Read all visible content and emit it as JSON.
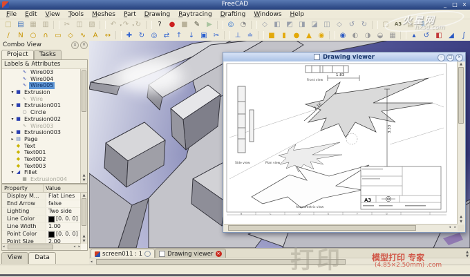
{
  "window": {
    "title": "FreeCAD",
    "controls": {
      "minimize": "_",
      "maximize": "□",
      "close": "×"
    }
  },
  "menu": {
    "items": [
      "File",
      "Edit",
      "View",
      "Tools",
      "Meshes",
      "Part",
      "Drawing",
      "Raytracing",
      "Drafting",
      "Windows",
      "Help"
    ]
  },
  "toolbars": {
    "row1": [
      {
        "name": "new-file",
        "glyph": "□",
        "color": "#c9ba7c"
      },
      {
        "name": "open-file",
        "glyph": "▤",
        "color": "#3a6fbd"
      },
      {
        "name": "save-file",
        "glyph": "▦",
        "color": "#b9b29a"
      },
      {
        "name": "print",
        "glyph": "▥",
        "color": "#b9b29a"
      },
      "|",
      {
        "name": "cut",
        "glyph": "✂",
        "color": "#b9b29a"
      },
      {
        "name": "copy",
        "glyph": "◫",
        "color": "#b9b29a"
      },
      {
        "name": "paste",
        "glyph": "▧",
        "color": "#b9b29a"
      },
      "|",
      {
        "name": "undo",
        "glyph": "↶",
        "color": "#b9b29a",
        "dd": true
      },
      {
        "name": "redo",
        "glyph": "↷",
        "color": "#b9b29a",
        "dd": true
      },
      {
        "name": "refresh",
        "glyph": "↻",
        "color": "#b9b29a"
      },
      "|",
      {
        "name": "whats-this",
        "glyph": "?",
        "color": "#1a1a1a"
      },
      {
        "name": "macro-record",
        "glyph": "●",
        "color": "#cc2020"
      },
      {
        "name": "macro-stop",
        "glyph": "■",
        "color": "#b9b29a"
      },
      {
        "name": "macro-edit",
        "glyph": "✎",
        "color": "#4a4a38"
      },
      {
        "name": "macro-play",
        "glyph": "▶",
        "color": "#a9c49f"
      },
      "|",
      {
        "name": "zoom-fit",
        "glyph": "◎",
        "color": "#2a6fd0"
      },
      {
        "name": "draw-style",
        "glyph": "◔",
        "color": "#8a8a8a"
      },
      "|",
      {
        "name": "view-axonometric",
        "glyph": "◇",
        "color": "#9aa0ab"
      },
      {
        "name": "view-front",
        "glyph": "◧",
        "color": "#9aa0ab"
      },
      {
        "name": "view-top",
        "glyph": "◩",
        "color": "#9aa0ab"
      },
      {
        "name": "view-right",
        "glyph": "◨",
        "color": "#9aa0ab"
      },
      {
        "name": "view-rear",
        "glyph": "◪",
        "color": "#9aa0ab"
      },
      {
        "name": "view-bottom",
        "glyph": "◫",
        "color": "#9aa0ab"
      },
      {
        "name": "view-left",
        "glyph": "◇",
        "color": "#9aa0ab"
      },
      {
        "name": "view-rotate-left",
        "glyph": "↺",
        "color": "#8b93a8"
      },
      {
        "name": "view-rotate-right",
        "glyph": "↻",
        "color": "#8b93a8"
      },
      "|",
      {
        "name": "drawing-new-page",
        "glyph": "▢",
        "color": "#b9b29a"
      },
      {
        "name": "drawing-a3-page",
        "glyph": "A3",
        "color": "#6a6a50",
        "small": true
      },
      {
        "name": "drawing-open-svg",
        "glyph": "▤",
        "color": "#b9b29a"
      },
      {
        "name": "drawing-export-page",
        "glyph": "⇩",
        "color": "#2a6fd0"
      }
    ],
    "row2": [
      {
        "name": "draft-line",
        "glyph": "/",
        "color": "#c79400"
      },
      {
        "name": "draft-wire",
        "glyph": "N",
        "color": "#c79400"
      },
      {
        "name": "draft-circle",
        "glyph": "○",
        "color": "#c79400"
      },
      {
        "name": "draft-arc",
        "glyph": "∩",
        "color": "#c79400"
      },
      {
        "name": "draft-rectangle",
        "glyph": "▭",
        "color": "#c79400"
      },
      {
        "name": "draft-polygon",
        "glyph": "◇",
        "color": "#c79400"
      },
      {
        "name": "draft-bspline",
        "glyph": "∿",
        "color": "#c79400"
      },
      {
        "name": "draft-text",
        "glyph": "A",
        "color": "#c79400"
      },
      {
        "name": "draft-dimension",
        "glyph": "↔",
        "color": "#c79400"
      },
      "|",
      {
        "name": "draft-move",
        "glyph": "✚",
        "color": "#2a5fd0"
      },
      {
        "name": "draft-rotate",
        "glyph": "↻",
        "color": "#2a5fd0"
      },
      {
        "name": "draft-snap",
        "glyph": "◎",
        "color": "#2a5fd0"
      },
      {
        "name": "draft-offset",
        "glyph": "⇄",
        "color": "#2a5fd0"
      },
      {
        "name": "draft-upgrade",
        "glyph": "↑",
        "color": "#2a5fd0"
      },
      {
        "name": "draft-downgrade",
        "glyph": "↓",
        "color": "#2a5fd0"
      },
      {
        "name": "draft-scale",
        "glyph": "▣",
        "color": "#2a5fd0"
      },
      {
        "name": "draft-trimex",
        "glyph": "✂",
        "color": "#2a5fd0"
      },
      "|",
      {
        "name": "draft-apply-plane",
        "glyph": "⊥",
        "color": "#2a5fd0"
      },
      {
        "name": "draft-toggle-mode",
        "glyph": "≐",
        "color": "#2a5fd0"
      },
      "|",
      {
        "name": "part-box",
        "glyph": "■",
        "color": "#e3a90a"
      },
      {
        "name": "part-cylinder",
        "glyph": "▮",
        "color": "#e3a90a"
      },
      {
        "name": "part-sphere",
        "glyph": "●",
        "color": "#e3a90a"
      },
      {
        "name": "part-cone",
        "glyph": "▲",
        "color": "#e3a90a"
      },
      {
        "name": "part-torus",
        "glyph": "◉",
        "color": "#e3a90a"
      },
      "|",
      {
        "name": "part-union",
        "glyph": "◉",
        "color": "#2857c2"
      },
      {
        "name": "part-common",
        "glyph": "◐",
        "color": "#9a9a9a"
      },
      {
        "name": "part-cut",
        "glyph": "◑",
        "color": "#9a9a9a"
      },
      {
        "name": "part-section",
        "glyph": "◒",
        "color": "#9a9a9a"
      },
      {
        "name": "part-compound",
        "glyph": "▦",
        "color": "#9a9a9a"
      },
      "|",
      {
        "name": "part-extrude",
        "glyph": "▴",
        "color": "#2857c2"
      },
      {
        "name": "part-revolve",
        "glyph": "↺",
        "color": "#2857c2"
      },
      {
        "name": "part-mirror",
        "glyph": "◧",
        "color": "#c23a3a"
      },
      {
        "name": "part-fillet",
        "glyph": "◢",
        "color": "#2857c2"
      },
      {
        "name": "part-sweep",
        "glyph": "∫",
        "color": "#2857c2"
      }
    ]
  },
  "combo_view": {
    "title": "Combo View",
    "tabs": [
      {
        "label": "Project",
        "active": true
      },
      {
        "label": "Tasks",
        "active": false
      }
    ],
    "tree_header": "Labels & Attributes",
    "icon_map": {
      "wire": {
        "glyph": "∿",
        "color": "#2a3fb0"
      },
      "extrusion": {
        "glyph": "■",
        "color": "#2a3fb0"
      },
      "circle": {
        "glyph": "○",
        "color": "#777777"
      },
      "page": {
        "glyph": "▤",
        "color": "#5577bb"
      },
      "text": {
        "glyph": "◆",
        "color": "#c9b400"
      },
      "fillet": {
        "glyph": "◢",
        "color": "#2a3fb0"
      }
    },
    "tree": [
      {
        "label": "Wire003",
        "icon": "wire",
        "depth": 2
      },
      {
        "label": "Wire004",
        "icon": "wire",
        "depth": 2
      },
      {
        "label": "Wire005",
        "icon": "wire",
        "depth": 2,
        "selected": true
      },
      {
        "label": "Extrusion",
        "icon": "extrusion",
        "depth": 1,
        "exp": "open"
      },
      {
        "label": "Wire",
        "icon": "wire",
        "depth": 2,
        "dim": true
      },
      {
        "label": "Extrusion001",
        "icon": "extrusion",
        "depth": 1,
        "exp": "open"
      },
      {
        "label": "Circle",
        "icon": "circle",
        "depth": 2
      },
      {
        "label": "Extrusion002",
        "icon": "extrusion",
        "depth": 1,
        "exp": "open"
      },
      {
        "label": "Wire003",
        "icon": "wire",
        "depth": 2,
        "dim": true
      },
      {
        "label": "Extrusion003",
        "icon": "extrusion",
        "depth": 1,
        "exp": "closed"
      },
      {
        "label": "Page",
        "icon": "page",
        "depth": 1,
        "exp": "closed"
      },
      {
        "label": "Text",
        "icon": "text",
        "depth": 1
      },
      {
        "label": "Text001",
        "icon": "text",
        "depth": 1
      },
      {
        "label": "Text002",
        "icon": "text",
        "depth": 1
      },
      {
        "label": "Text003",
        "icon": "text",
        "depth": 1
      },
      {
        "label": "Fillet",
        "icon": "fillet",
        "depth": 1,
        "exp": "open"
      },
      {
        "label": "Extrusion004",
        "icon": "extrusion",
        "depth": 2,
        "dim": true
      }
    ],
    "property_panel": {
      "columns": [
        "Property",
        "Value"
      ],
      "rows": [
        {
          "property": "Display M...",
          "value": "Flat Lines"
        },
        {
          "property": "End Arrow",
          "value": "false"
        },
        {
          "property": "Lighting",
          "value": "Two side"
        },
        {
          "property": "Line Color",
          "value": "[0. 0. 0]",
          "swatch": "#000000"
        },
        {
          "property": "Line Width",
          "value": "1.00"
        },
        {
          "property": "Point Color",
          "value": "[0. 0. 0]",
          "swatch": "#000000"
        },
        {
          "property": "Point Size",
          "value": "2.00"
        }
      ]
    },
    "bottom_tabs": [
      {
        "label": "View",
        "active": false
      },
      {
        "label": "Data",
        "active": true
      }
    ]
  },
  "drawing_viewer": {
    "title": "Drawing viewer",
    "labels": {
      "front": "Front view",
      "side": "Side view",
      "plan": "Plan view",
      "axo": "Axonometric view"
    },
    "dims": {
      "d1": "1.83",
      "d2": "2.16",
      "d3": "3.33"
    },
    "sheet_format": "A3"
  },
  "mdi": {
    "tabs": [
      {
        "label": "screen011 : 1",
        "active": true
      },
      {
        "label": "Drawing viewer",
        "active": false
      }
    ]
  },
  "watermarks": {
    "site_name": "火星网",
    "site_domain": "hxsd.com",
    "promo_big": "打印",
    "promo_red1": "模型打印 专家",
    "promo_red2": "(4.85×2.50mm) .com"
  }
}
